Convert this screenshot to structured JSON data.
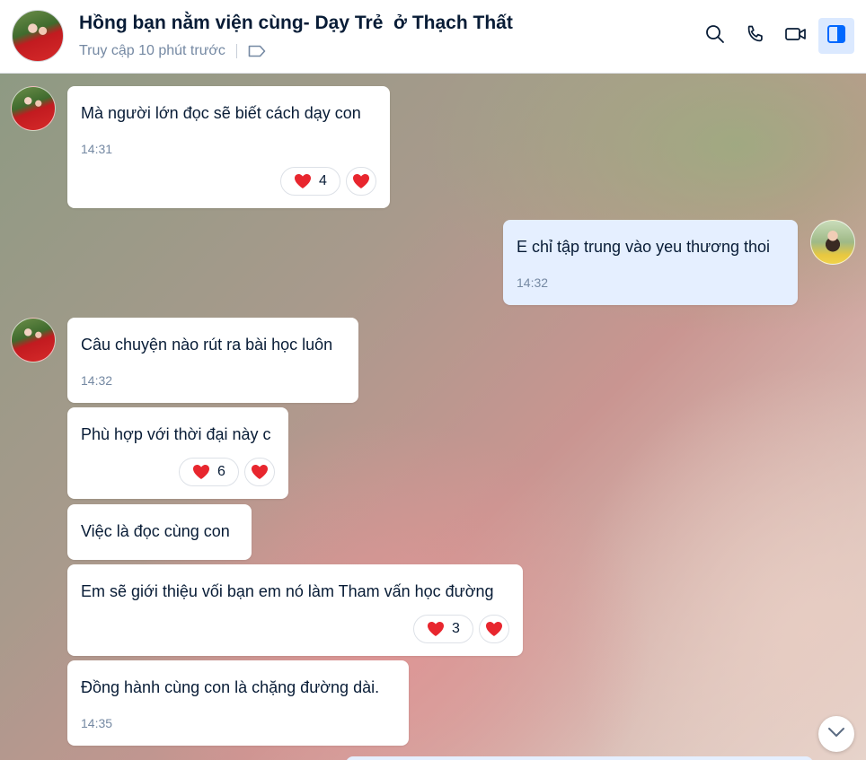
{
  "header": {
    "title": "Hồng bạn nằm viện cùng- Dạy Trẻ  ở Thạch Thất",
    "last_seen": "Truy cập 10 phút trước"
  },
  "icons": {
    "search": "search-icon",
    "call": "phone-icon",
    "video": "video-camera-icon",
    "panel": "side-panel-icon",
    "tag": "tag-icon",
    "heart": "heart-icon",
    "scroll": "chevron-down-icon"
  },
  "colors": {
    "accent": "#0068ff",
    "mine_bubble": "#e5efff",
    "heart": "#e8262e"
  },
  "messages": [
    {
      "text": "Mà người lớn đọc sẽ biết cách dạy con",
      "time": "14:31",
      "reaction_count": "4"
    },
    {
      "text": "E chỉ tập trung vào yeu thương thoi",
      "time": "14:32"
    },
    {
      "text": "Câu chuyện nào rút ra bài học luôn",
      "time": "14:32"
    },
    {
      "text": "Phù hợp với thời đại này c",
      "reaction_count": "6"
    },
    {
      "text": "Việc là đọc cùng con"
    },
    {
      "text": "Em sẽ giới thiệu vối bạn em nó làm Tham vấn học đường",
      "reaction_count": "3"
    },
    {
      "text": "Đồng hành cùng con là chặng đường dài.",
      "time": "14:35"
    }
  ]
}
